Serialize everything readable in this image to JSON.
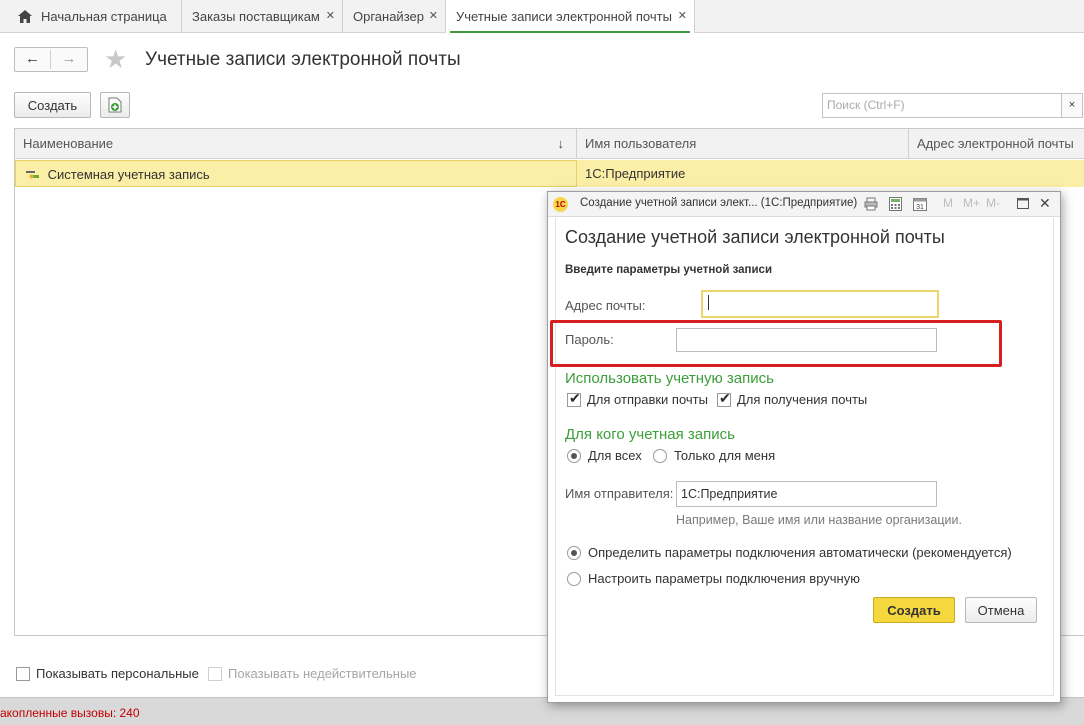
{
  "tabs": [
    {
      "label": "Начальная страница",
      "closable": false,
      "active": false
    },
    {
      "label": "Заказы поставщикам",
      "closable": true,
      "active": false
    },
    {
      "label": "Органайзер",
      "closable": true,
      "active": false
    },
    {
      "label": "Учетные записи электронной почты",
      "closable": true,
      "active": true
    }
  ],
  "icons": {
    "home": "home-icon",
    "back": "←",
    "forward": "→",
    "star": "★",
    "close": "✕",
    "sort_down": "↓"
  },
  "page": {
    "title": "Учетные записи электронной почты"
  },
  "toolbar": {
    "create_label": "Создать",
    "search_placeholder": "Поиск (Ctrl+F)",
    "search_clear": "×"
  },
  "table": {
    "columns": [
      "Наименование",
      "Имя пользователя",
      "Адрес электронной почты"
    ],
    "rows": [
      {
        "name": "Системная учетная запись",
        "user": "1С:Предприятие",
        "email": ""
      }
    ]
  },
  "footer": {
    "show_personal": "Показывать персональные",
    "show_invalid": "Показывать недействительные",
    "status": "акопленные вызовы: 240"
  },
  "dialog": {
    "caption": "Создание учетной записи элект...   (1С:Предприятие)",
    "logo": "1С",
    "toolbar_icons": [
      "M",
      "M+",
      "M-"
    ],
    "heading": "Создание учетной записи электронной почты",
    "subheading": "Введите параметры учетной записи",
    "email_label": "Адрес почты:",
    "email_value": "",
    "password_label": "Пароль:",
    "password_value": "",
    "use_section": "Использовать учетную запись",
    "use_send": "Для отправки почты",
    "use_receive": "Для получения почты",
    "for_whom_section": "Для кого учетная запись",
    "for_all": "Для всех",
    "only_me": "Только для меня",
    "sender_label": "Имя отправителя:",
    "sender_value": "1С:Предприятие",
    "sender_hint": "Например, Ваше имя или название организации.",
    "auto_params": "Определить параметры подключения автоматически (рекомендуется)",
    "manual_params": "Настроить параметры подключения вручную",
    "create_button": "Создать",
    "cancel_button": "Отмена",
    "accent": "#f5d83d",
    "highlight_color": "#d61f1f",
    "section_color": "#3b9e3b"
  }
}
